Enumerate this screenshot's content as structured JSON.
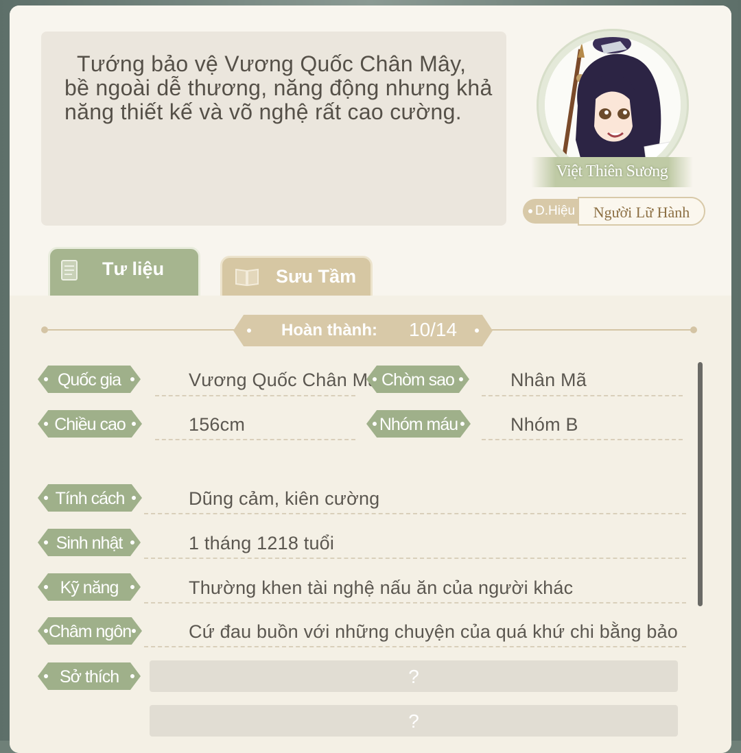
{
  "profile": {
    "description": "Tướng bảo vệ Vương Quốc Chân Mây, bề ngoài dễ thương, năng động nhưng khả năng thiết kế và võ nghệ rất cao cường.",
    "name": "Việt Thiên Sương",
    "title_tag": "D.Hiệu",
    "title_name": "Người Lữ Hành"
  },
  "tabs": [
    {
      "label": "Tư liệu",
      "icon": "document-icon",
      "active": true
    },
    {
      "label": "Sưu Tầm",
      "icon": "book-icon",
      "active": false
    }
  ],
  "progress": {
    "label": "Hoàn thành:",
    "value": "10/14"
  },
  "info_grid": [
    {
      "label": "Quốc gia",
      "value": "Vương Quốc Chân Mây"
    },
    {
      "label": "Chòm sao",
      "value": "Nhân Mã"
    },
    {
      "label": "Chiều cao",
      "value": "156cm"
    },
    {
      "label": "Nhóm máu",
      "value": "Nhóm B"
    }
  ],
  "info_rows": [
    {
      "label": "Tính cách",
      "value": "Dũng cảm, kiên cường"
    },
    {
      "label": "Sinh nhật",
      "value": "1 tháng 1218 tuổi"
    },
    {
      "label": "Kỹ năng",
      "value": "Thường khen tài nghệ nấu ăn của người khác"
    },
    {
      "label": "Châm ngôn",
      "value": "Cứ đau buồn với những chuyện của quá khứ chi bằng bảo"
    }
  ],
  "hobby": {
    "label": "Sở thích",
    "unknown_1": "?",
    "unknown_2": "?"
  },
  "colors": {
    "label_green": "#9fb08a",
    "tan": "#d8c9a8",
    "panel": "#f7f3ea"
  }
}
